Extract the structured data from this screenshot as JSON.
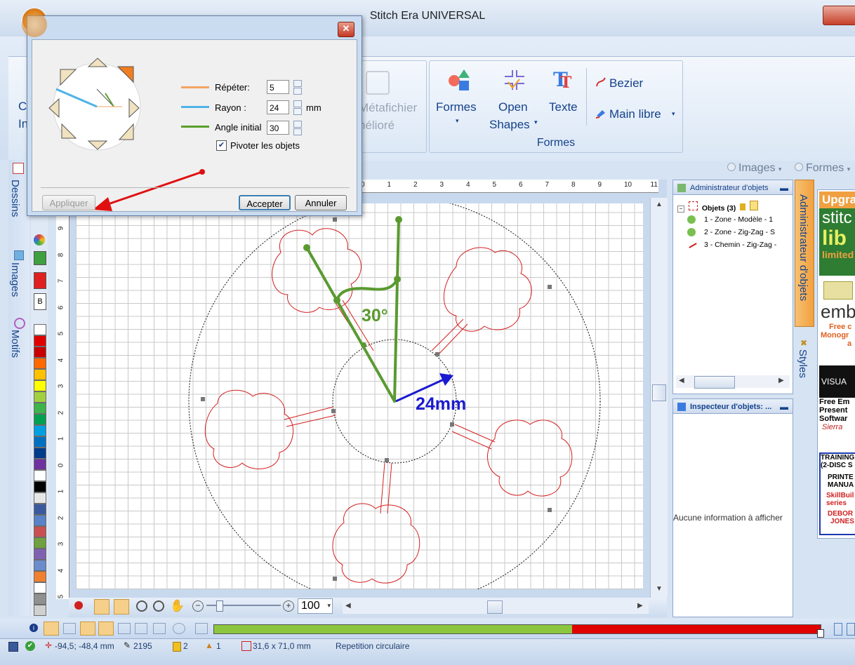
{
  "window": {
    "title": "Stitch Era UNIVERSAL"
  },
  "ribbon": {
    "partial_left_1": "C",
    "partial_left_2": "In",
    "metafile_line1": "Métafichier",
    "metafile_line2": "nélioré",
    "formes_label": "Formes",
    "open_shapes_line1": "Open",
    "open_shapes_line2": "Shapes",
    "texte_label": "Texte",
    "bezier_label": "Bezier",
    "main_libre_label": "Main libre",
    "group_label": "Formes",
    "tab_images": "Images",
    "tab_formes": "Formes"
  },
  "left_tabs": [
    "Dessins",
    "Images",
    "Motifs"
  ],
  "palette": {
    "colors": [
      "#ffffff",
      "#e00000",
      "#c80000",
      "#ff6a00",
      "#ffc000",
      "#ffff00",
      "#a0d040",
      "#3cb44b",
      "#00a050",
      "#00a0e0",
      "#0070c0",
      "#003c8c",
      "#7030a0",
      "#ffffff",
      "#000000",
      "#e6e6e6",
      "#3a5aa0",
      "#5a82c8",
      "#c85050",
      "#70a040",
      "#8060b0",
      "#6a8ccc",
      "#f08030",
      "#ffffff",
      "#909090",
      "#d0d0d0"
    ]
  },
  "dialog": {
    "repeat_label": "Répéter:",
    "repeat_value": "5",
    "radius_label": "Rayon :",
    "radius_value": "24",
    "radius_unit": "mm",
    "angle_label": "Angle initial",
    "angle_value": "30",
    "rotate_label": "Pivoter les objets",
    "apply_button": "Appliquer",
    "accept_button": "Accepter",
    "cancel_button": "Annuler",
    "repeat_color": "#f4a460",
    "radius_color": "#4fb3e8",
    "angle_color": "#5aa02c"
  },
  "annotations": {
    "angle_text": "30°",
    "radius_text": "24mm"
  },
  "ruler_top": [
    "0",
    "1",
    "2",
    "3",
    "4",
    "5",
    "6",
    "7",
    "8",
    "9",
    "10",
    "11"
  ],
  "ruler_left": [
    "9",
    "8",
    "7",
    "6",
    "5",
    "4",
    "3",
    "2",
    "1",
    "0",
    "1",
    "2",
    "3",
    "4",
    "5"
  ],
  "object_manager": {
    "title": "Administrateur d'objets",
    "root_label": "Objets (3)",
    "items": [
      "1 - Zone - Modèle - 1",
      "2 - Zone - Zig-Zag - S",
      "3 - Chemin - Zig-Zag -"
    ]
  },
  "inspector": {
    "title": "Inspecteur d'objets: ...",
    "empty_text": "Aucune information à afficher"
  },
  "right_tabs": [
    "Administrateur d'objets",
    "Styles"
  ],
  "ads": {
    "ad1_line1": "Upgra",
    "ad1_line2": "stitc",
    "ad1_line3": "lib",
    "ad1_line4": "limited",
    "ad2_line1": "emb",
    "ad2_line2": "Free c",
    "ad2_line3": "Monogr",
    "ad2_line4": "a",
    "ad3_line1": "VISUA",
    "ad3_line2": "Free Em",
    "ad3_line3": "Present",
    "ad3_line4": "Softwar",
    "ad3_line5": "Sierra",
    "ad4_line1": "TRAINING",
    "ad4_line2": "(2-DISC S",
    "ad4_line3": "PRINTE",
    "ad4_line4": "MANUA",
    "ad4_line5": "SkillBuil",
    "ad4_line6": "series",
    "ad4_line7": "DEBOR",
    "ad4_line8": "JONES"
  },
  "zoom": {
    "value": "100"
  },
  "progress": {
    "green_fraction": 0.59
  },
  "status": {
    "coords": "-94,5; -48,4 mm",
    "stitches": "2195",
    "colors": "2",
    "count": "1",
    "size": "31,6 x 71,0 mm",
    "mode": "Repetition circulaire"
  }
}
